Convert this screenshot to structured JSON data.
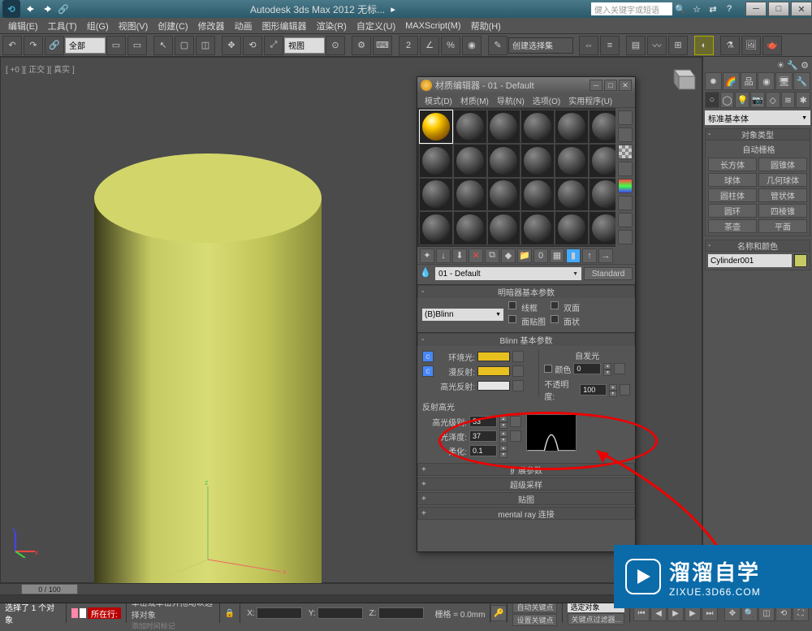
{
  "titlebar": {
    "title": "Autodesk 3ds Max  2012        无标...",
    "search_placeholder": "健入关键字或短语"
  },
  "menubar": [
    "编辑(E)",
    "工具(T)",
    "组(G)",
    "视图(V)",
    "创建(C)",
    "修改器",
    "动画",
    "图形编辑器",
    "渲染(R)",
    "自定义(U)",
    "MAXScript(M)",
    "帮助(H)"
  ],
  "toolbar": {
    "layer_dd": "全部",
    "view_dd": "视图",
    "selset_dd": "创建选择集"
  },
  "viewport": {
    "label": "[ +0 ][ 正交 ][ 真实 ]"
  },
  "material_editor": {
    "title": "材质编辑器 - 01 - Default",
    "menu": [
      "模式(D)",
      "材质(M)",
      "导航(N)",
      "选项(O)",
      "实用程序(U)"
    ],
    "name": "01 - Default",
    "type_btn": "Standard",
    "rollup_shader": {
      "title": "明暗器基本参数",
      "shader": "(B)Blinn",
      "opt_wire": "线框",
      "opt_2side": "双面",
      "opt_facemap": "面贴图",
      "opt_faceted": "面状"
    },
    "rollup_blinn": {
      "title": "Blinn 基本参数",
      "ambient": "环境光:",
      "diffuse": "漫反射:",
      "specular": "高光反射:",
      "selfillum_title": "自发光",
      "selfillum_color": "颜色",
      "selfillum_val": "0",
      "opacity_label": "不透明度:",
      "opacity_val": "100",
      "spec_title": "反射高光",
      "spec_level_label": "高光级别:",
      "spec_level_val": "53",
      "gloss_label": "光泽度:",
      "gloss_val": "37",
      "soften_label": "柔化:",
      "soften_val": "0.1",
      "colors": {
        "ambient": "#e8c020",
        "diffuse": "#e8c020",
        "specular": "#e6e6e6"
      }
    },
    "closed_rollups": [
      "扩展参数",
      "超级采样",
      "贴图",
      "mental ray 连接"
    ]
  },
  "right_panel": {
    "primitive_dd": "标准基本体",
    "obj_type_title": "对象类型",
    "autogrid": "自动栅格",
    "buttons": [
      [
        "长方体",
        "圆锥体"
      ],
      [
        "球体",
        "几何球体"
      ],
      [
        "圆柱体",
        "管状体"
      ],
      [
        "圆环",
        "四棱锥"
      ],
      [
        "茶壶",
        "平面"
      ]
    ],
    "name_title": "名称和颜色",
    "name_value": "Cylinder001"
  },
  "status": {
    "time_slider": "0 / 100",
    "sel_text": "选择了 1 个对象",
    "location": "所在行:",
    "prompt": "单击或单击并拖动以选择对象",
    "add_time_tag": "添加时间标记",
    "grid": "栅格 = 0.0mm",
    "autokey": "自动关键点",
    "setkey": "设置关键点",
    "selset": "选定对象",
    "keyfilter": "关键点过滤器..."
  },
  "watermark": {
    "big": "溜溜自学",
    "small": "ZIXUE.3D66.COM"
  }
}
